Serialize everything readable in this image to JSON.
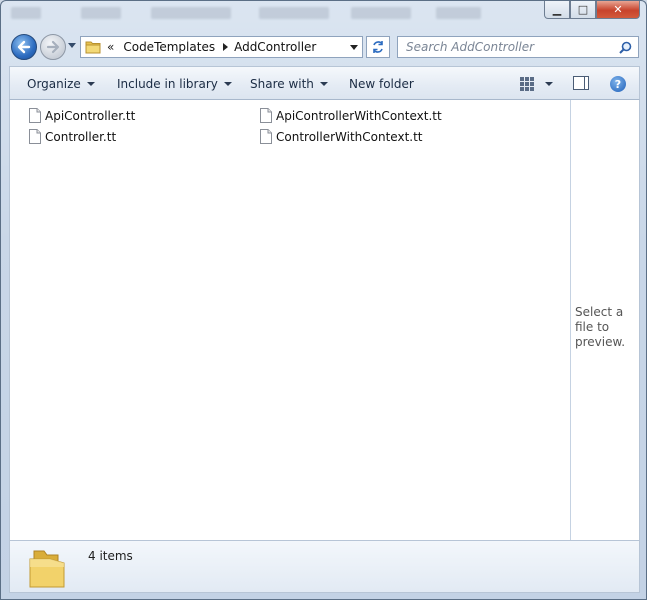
{
  "window": {
    "caption_minimize": "▁",
    "caption_maximize": "□",
    "caption_close": "✕"
  },
  "nav": {
    "back_icon": "back-arrow-icon",
    "forward_icon": "forward-arrow-icon",
    "address_chevron": "«",
    "breadcrumb": [
      "CodeTemplates",
      "AddController"
    ],
    "search_placeholder": "Search AddController"
  },
  "toolbar": {
    "organize": "Organize",
    "include_in_library": "Include in library",
    "share_with": "Share with",
    "new_folder": "New folder",
    "help": "?"
  },
  "files": [
    {
      "name": "ApiController.tt"
    },
    {
      "name": "Controller.tt"
    },
    {
      "name": "ApiControllerWithContext.tt"
    },
    {
      "name": "ControllerWithContext.tt"
    }
  ],
  "preview": {
    "message": "Select a file to preview."
  },
  "details": {
    "item_count": "4 items"
  },
  "colors": {
    "frame": "#c9d7e8",
    "accent": "#2d6cc0",
    "close": "#c7432c"
  }
}
